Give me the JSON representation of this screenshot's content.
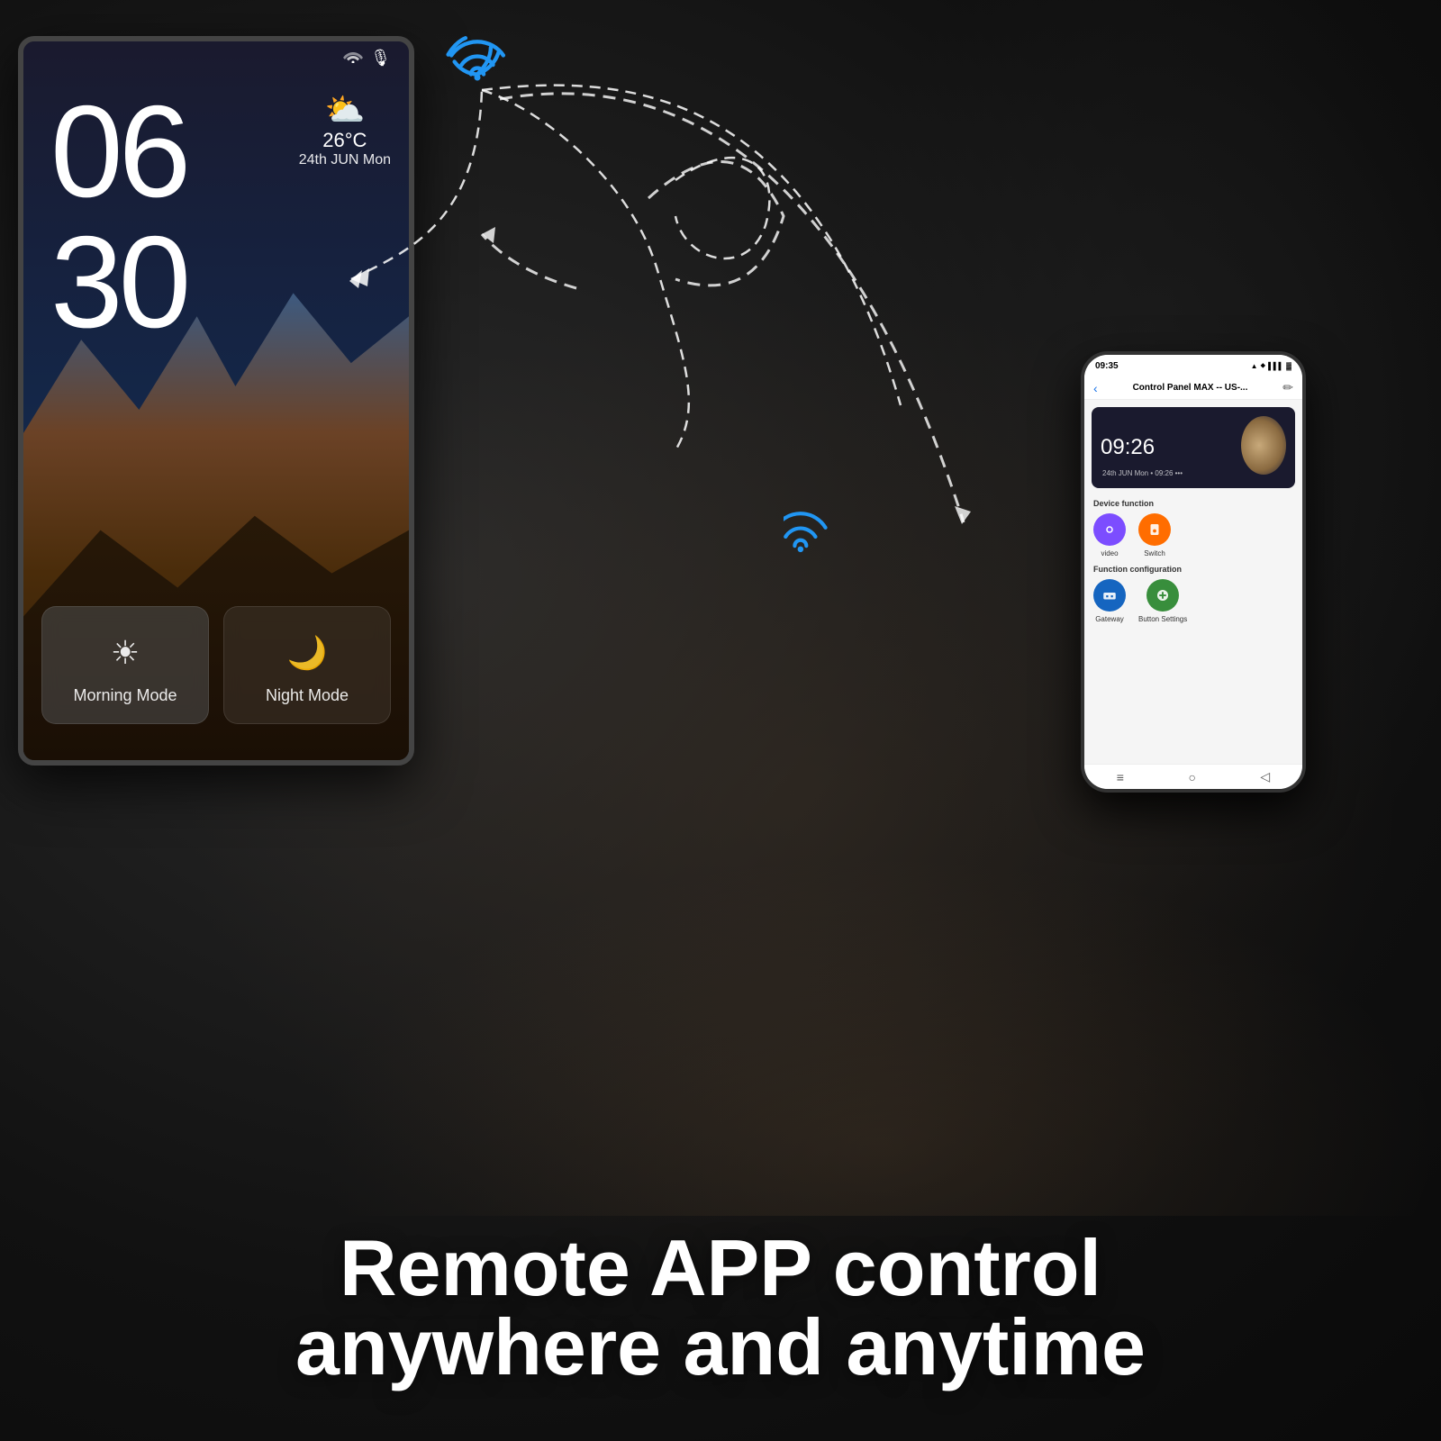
{
  "page": {
    "title": "Remote APP control anywhere and anytime",
    "background_color": "#1a1a1a"
  },
  "tablet": {
    "time_hours": "06",
    "time_minutes": "30",
    "weather_temp": "26°C",
    "weather_date": "24th JUN Mon",
    "weather_icon": "⛅",
    "mode1_label": "Morning Mode",
    "mode1_icon": "☀",
    "mode2_label": "Night Mode",
    "mode2_icon": "🌙"
  },
  "phone": {
    "status_time": "09:35",
    "app_title": "Control Panel MAX -- US-...",
    "preview_time": "09:26",
    "preview_date": "24th JUN Mon • 09:26 •••",
    "device_function_label": "Device function",
    "function_config_label": "Function configuration",
    "icons": [
      {
        "label": "video",
        "color": "icon-purple",
        "symbol": "📹"
      },
      {
        "label": "Switch",
        "color": "icon-orange",
        "symbol": "🔌"
      },
      {
        "label": "Gateway",
        "color": "icon-blue",
        "symbol": "🌐"
      },
      {
        "label": "Button Settings",
        "color": "icon-green",
        "symbol": "⚙"
      }
    ]
  },
  "bottom_text": {
    "line1": "Remote APP control",
    "line2": "anywhere and anytime"
  }
}
